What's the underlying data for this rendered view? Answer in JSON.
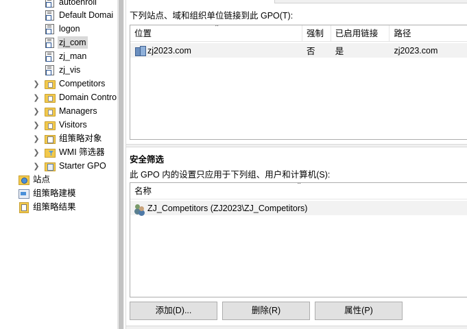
{
  "tree": {
    "items": [
      {
        "label": "autoenroll",
        "icon": "gpo-link-icon"
      },
      {
        "label": "Default Domai",
        "icon": "gpo-link-icon"
      },
      {
        "label": "logon",
        "icon": "gpo-link-icon"
      },
      {
        "label": "zj_com",
        "icon": "gpo-link-icon",
        "selected": true
      },
      {
        "label": "zj_man",
        "icon": "gpo-link-icon"
      },
      {
        "label": "zj_vis",
        "icon": "gpo-link-icon"
      },
      {
        "label": "Competitors",
        "icon": "ou-icon",
        "expandable": true
      },
      {
        "label": "Domain Contro",
        "icon": "ou-icon",
        "expandable": true
      },
      {
        "label": "Managers",
        "icon": "ou-icon",
        "expandable": true
      },
      {
        "label": "Visitors",
        "icon": "ou-icon",
        "expandable": true
      },
      {
        "label": "组策略对象",
        "icon": "gpo-folder-icon",
        "expandable": true
      },
      {
        "label": "WMI 筛选器",
        "icon": "wmi-filter-icon",
        "expandable": true
      },
      {
        "label": "Starter GPO",
        "icon": "starter-gpo-icon",
        "expandable": true
      },
      {
        "label": "站点",
        "icon": "sites-icon"
      },
      {
        "label": "组策略建模",
        "icon": "gp-modeling-icon"
      },
      {
        "label": "组策略结果",
        "icon": "gp-results-icon"
      }
    ]
  },
  "links": {
    "caption": "下列站点、域和组织单位链接到此 GPO(T):",
    "columns": [
      "位置",
      "强制",
      "已启用链接",
      "路径"
    ],
    "rows": [
      {
        "location": "zj2023.com",
        "enforced": "否",
        "link_enabled": "是",
        "path": "zj2023.com"
      }
    ]
  },
  "security": {
    "title": "安全筛选",
    "caption": "此 GPO 内的设置只应用于下列组、用户和计算机(S):",
    "column_name": "名称",
    "rows": [
      {
        "name": "ZJ_Competitors (ZJ2023\\ZJ_Competitors)"
      }
    ],
    "buttons": {
      "add": "添加(D)...",
      "remove": "删除(R)",
      "properties": "属性(P)"
    }
  },
  "colors": {
    "selected_bg": "#d9d9d9",
    "row_bg": "#f2f2f2",
    "button_bg": "#e1e1e1",
    "folder": "#f2c94c"
  }
}
